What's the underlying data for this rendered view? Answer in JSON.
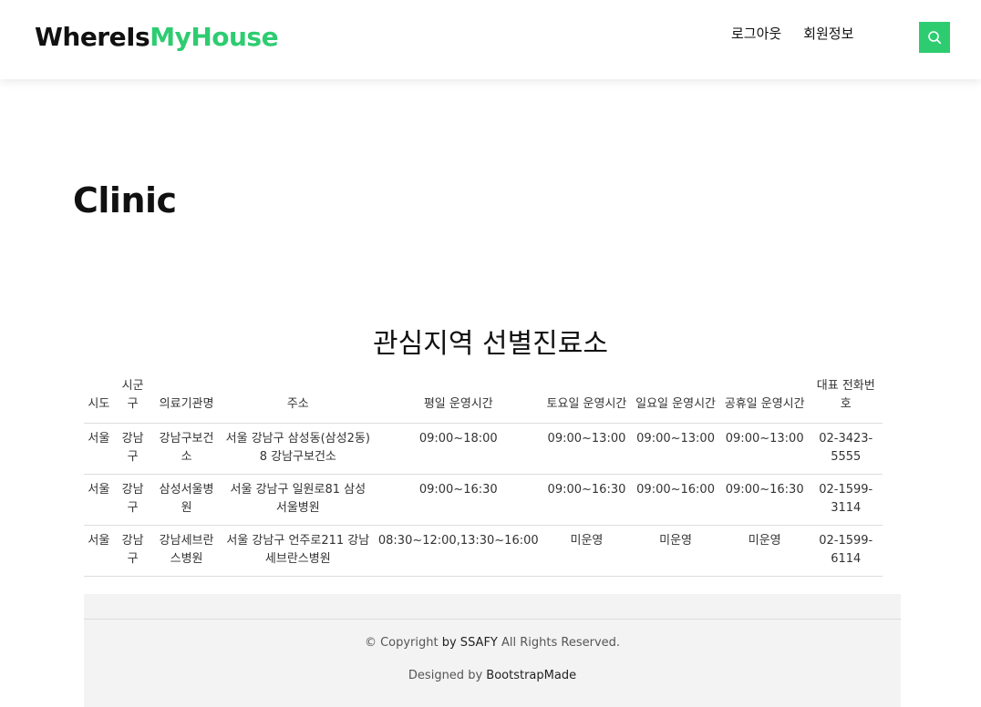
{
  "header": {
    "logo_part1": "WhereIs",
    "logo_part2": "MyHouse",
    "nav": [
      {
        "label": "로그아웃"
      },
      {
        "label": "회원정보"
      }
    ]
  },
  "page": {
    "title": "Clinic",
    "section_title": "관심지역 선별진료소"
  },
  "table": {
    "headers": [
      "시도",
      "시군구",
      "의료기관명",
      "주소",
      "평일 운영시간",
      "토요일 운영시간",
      "일요일 운영시간",
      "공휴일 운영시간",
      "대표 전화번호"
    ],
    "rows": [
      [
        "서울",
        "강남구",
        "강남구보건소",
        "서울 강남구 삼성동(삼성2동) 8 강남구보건소",
        "09:00~18:00",
        "09:00~13:00",
        "09:00~13:00",
        "09:00~13:00",
        "02-3423-5555"
      ],
      [
        "서울",
        "강남구",
        "삼성서울병원",
        "서울 강남구 일원로81 삼성서울병원",
        "09:00~16:30",
        "09:00~16:30",
        "09:00~16:00",
        "09:00~16:30",
        "02-1599-3114"
      ],
      [
        "서울",
        "강남구",
        "강남세브란스병원",
        "서울 강남구 언주로211 강남세브란스병원",
        "08:30~12:00,13:30~16:00",
        "미운영",
        "미운영",
        "미운영",
        "02-1599-6114"
      ]
    ]
  },
  "footer": {
    "copy_prefix": "© Copyright",
    "copy_owner": "by SSAFY",
    "copy_suffix": "All Rights Reserved.",
    "designed_prefix": "Designed by",
    "designed_by": "BootstrapMade"
  },
  "colors": {
    "accent": "#2ecc71"
  }
}
